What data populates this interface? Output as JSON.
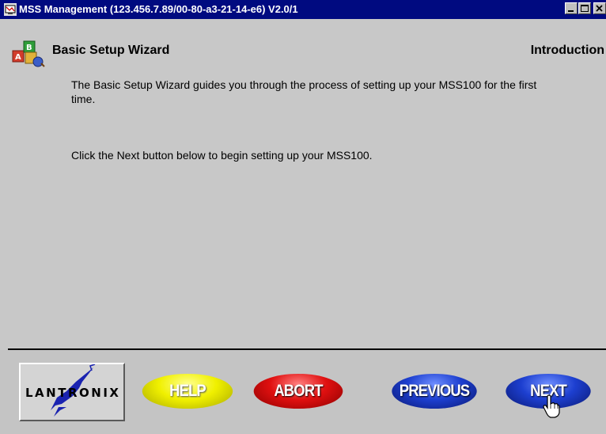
{
  "window": {
    "title": "MSS Management (123.456.7.89/00-80-a3-21-14-e6) V2.0/1",
    "buttons": [
      "minimize-icon",
      "maximize-icon",
      "close-icon"
    ]
  },
  "header": {
    "wizard_title": "Basic Setup Wizard",
    "step_title": "Introduction"
  },
  "content": {
    "paragraph1": "The Basic Setup Wizard guides you through the process of setting up your MSS100 for the first time.",
    "paragraph2": "Click the Next button below to begin setting up your MSS100."
  },
  "footer": {
    "logo_text": "LANTRONIX",
    "help_label": "HELP",
    "abort_label": "ABORT",
    "previous_label": "PREVIOUS",
    "next_label": "NEXT"
  },
  "colors": {
    "titlebar": "#000a80",
    "help": "#f0f000",
    "abort": "#e01010",
    "previous": "#1d3fd0",
    "next": "#1d3fd0"
  }
}
